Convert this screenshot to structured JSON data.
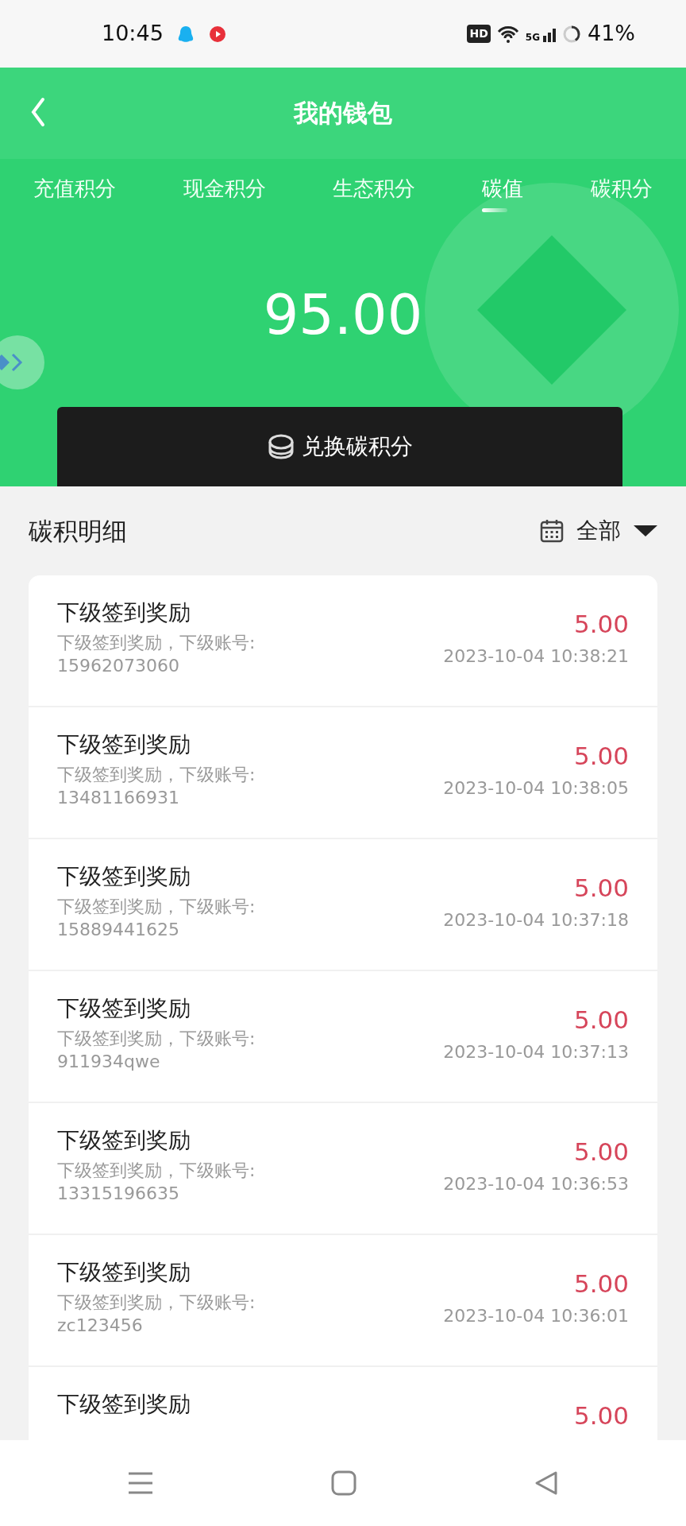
{
  "status_bar": {
    "time": "10:45",
    "hd": "HD",
    "network": "5G",
    "battery": "41%"
  },
  "header": {
    "title": "我的钱包"
  },
  "tabs": [
    {
      "label": "充值积分",
      "selected": false
    },
    {
      "label": "现金积分",
      "selected": false
    },
    {
      "label": "生态积分",
      "selected": false
    },
    {
      "label": "碳值",
      "selected": true
    },
    {
      "label": "碳积分",
      "selected": false
    }
  ],
  "balance": "95.00",
  "exchange_button": "兑换碳积分",
  "section": {
    "title": "碳积明细",
    "filter": "全部"
  },
  "records": [
    {
      "title": "下级签到奖励",
      "detail": "下级签到奖励，下级账号:",
      "account": "15962073060",
      "amount": "5.00",
      "time": "2023-10-04 10:38:21"
    },
    {
      "title": "下级签到奖励",
      "detail": "下级签到奖励，下级账号:",
      "account": "13481166931",
      "amount": "5.00",
      "time": "2023-10-04 10:38:05"
    },
    {
      "title": "下级签到奖励",
      "detail": "下级签到奖励，下级账号:",
      "account": "15889441625",
      "amount": "5.00",
      "time": "2023-10-04 10:37:18"
    },
    {
      "title": "下级签到奖励",
      "detail": "下级签到奖励，下级账号:",
      "account": "911934qwe",
      "amount": "5.00",
      "time": "2023-10-04 10:37:13"
    },
    {
      "title": "下级签到奖励",
      "detail": "下级签到奖励，下级账号:",
      "account": "13315196635",
      "amount": "5.00",
      "time": "2023-10-04 10:36:53"
    },
    {
      "title": "下级签到奖励",
      "detail": "下级签到奖励，下级账号:",
      "account": "zc123456",
      "amount": "5.00",
      "time": "2023-10-04 10:36:01"
    },
    {
      "title": "下级签到奖励",
      "amount": "5.00"
    }
  ]
}
